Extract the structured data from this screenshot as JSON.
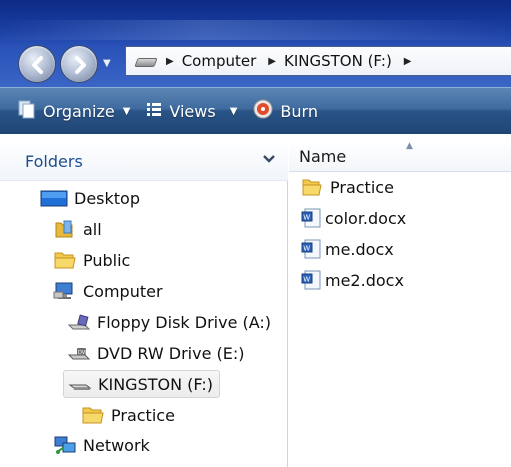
{
  "address": {
    "crumbs": [
      "Computer",
      "KINGSTON (F:)"
    ]
  },
  "toolbar": {
    "organize_label": "Organize",
    "views_label": "Views",
    "burn_label": "Burn"
  },
  "folders_pane": {
    "title": "Folders",
    "items": [
      {
        "label": "Desktop",
        "icon": "desktop-icon"
      },
      {
        "label": "all",
        "icon": "user-folder-icon"
      },
      {
        "label": "Public",
        "icon": "folder-icon"
      },
      {
        "label": "Computer",
        "icon": "computer-icon"
      },
      {
        "label": "Floppy Disk Drive (A:)",
        "icon": "floppy-drive-icon"
      },
      {
        "label": "DVD RW Drive (E:)",
        "icon": "dvd-drive-icon"
      },
      {
        "label": "KINGSTON (F:)",
        "icon": "usb-drive-icon",
        "selected": true
      },
      {
        "label": "Practice",
        "icon": "folder-icon"
      },
      {
        "label": "Network",
        "icon": "network-icon"
      }
    ]
  },
  "file_list": {
    "column_name": "Name",
    "items": [
      {
        "label": "Practice",
        "icon": "folder-icon"
      },
      {
        "label": "color.docx",
        "icon": "word-document-icon"
      },
      {
        "label": "me.docx",
        "icon": "word-document-icon"
      },
      {
        "label": "me2.docx",
        "icon": "word-document-icon"
      }
    ]
  },
  "colors": {
    "title_bar": "#1a3d9e",
    "toolbar": "#2f5b90",
    "folders_title": "#1e4e8c",
    "selection_bg": "#ececec"
  }
}
